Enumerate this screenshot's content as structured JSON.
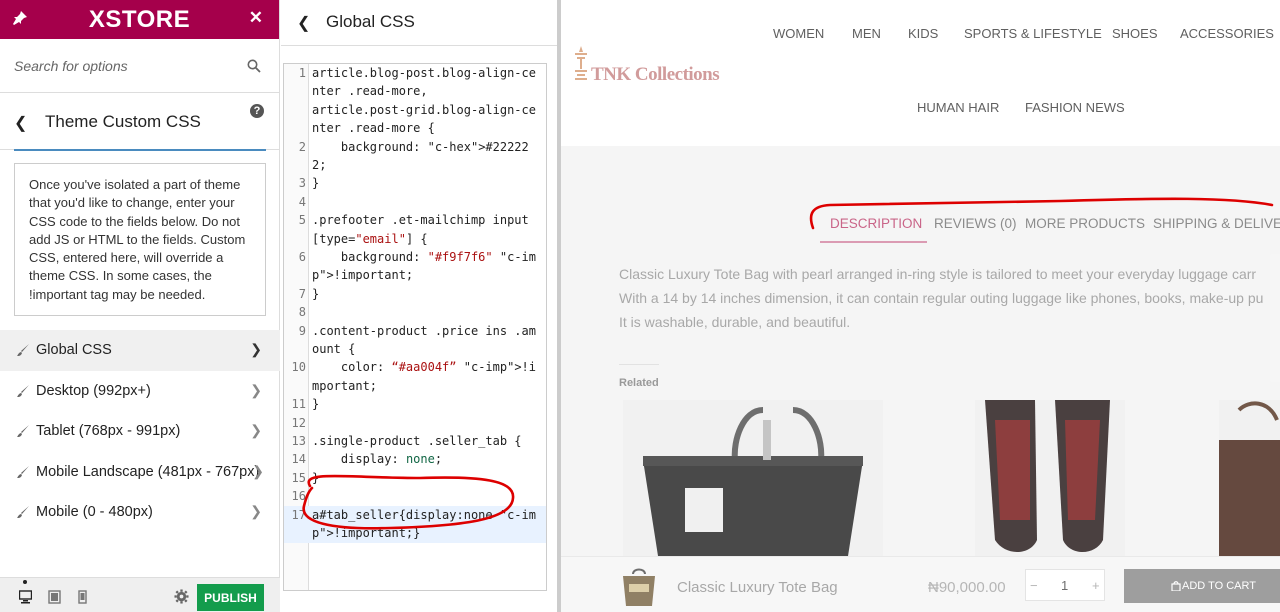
{
  "brand": {
    "logo": "XSTORE"
  },
  "search": {
    "placeholder": "Search for options"
  },
  "section": {
    "title": "Theme Custom CSS",
    "help": "?",
    "notice": "Once you've isolated a part of theme that you'd like to change, enter your CSS code to the fields below. Do not add JS or HTML to the fields. Custom CSS, entered here, will override a theme CSS. In some cases, the !important tag may be needed."
  },
  "menu": {
    "items": [
      {
        "label": "Global CSS"
      },
      {
        "label": "Desktop (992px+)"
      },
      {
        "label": "Tablet (768px - 991px)"
      },
      {
        "label": "Mobile Landscape (481px - 767px)"
      },
      {
        "label": "Mobile (0 - 480px)"
      }
    ]
  },
  "footer": {
    "publish": "PUBLISH"
  },
  "editor": {
    "title": "Global CSS",
    "lines": [
      {
        "n": "1",
        "text": "article.blog-post.blog-align-center .read-more,\narticle.post-grid.blog-align-center .read-more {"
      },
      {
        "n": "2",
        "text": "    background: #222222;"
      },
      {
        "n": "3",
        "text": "}"
      },
      {
        "n": "4",
        "text": ""
      },
      {
        "n": "5",
        "text": ".prefooter .et-mailchimp input[type=\"email\"] {"
      },
      {
        "n": "6",
        "text": "    background: \"#f9f7f6\" !important;"
      },
      {
        "n": "7",
        "text": "}"
      },
      {
        "n": "8",
        "text": ""
      },
      {
        "n": "9",
        "text": ".content-product .price ins .amount {"
      },
      {
        "n": "10",
        "text": "    color: “#aa004f” !important;"
      },
      {
        "n": "11",
        "text": "}"
      },
      {
        "n": "12",
        "text": ""
      },
      {
        "n": "13",
        "text": ".single-product .seller_tab {"
      },
      {
        "n": "14",
        "text": "    display: none;"
      },
      {
        "n": "15",
        "text": "}"
      },
      {
        "n": "16",
        "text": ""
      },
      {
        "n": "17",
        "text": "a#tab_seller{display:none !important;}"
      }
    ]
  },
  "preview": {
    "nav": [
      "WOMEN",
      "MEN",
      "KIDS",
      "SPORTS & LIFESTYLE",
      "SHOES",
      "ACCESSORIES",
      "HUMAN HAIR",
      "FASHION NEWS"
    ],
    "logo": "TNK Collections",
    "tabs": [
      "DESCRIPTION",
      "REVIEWS (0)",
      "MORE PRODUCTS",
      "SHIPPING & DELIVER"
    ],
    "description": [
      "Classic Luxury Tote Bag with pearl arranged in-ring style is tailored to meet your everyday luggage carr",
      "With a 14 by 14 inches dimension, it can contain regular outing luggage like phones, books, make-up pu",
      "It is washable, durable, and beautiful."
    ],
    "related": "Related",
    "sticky": {
      "product": "Classic Luxury Tote Bag",
      "price": "₦90,000.00",
      "qty_minus": "−",
      "qty": "1",
      "qty_plus": "+",
      "add_to_cart": "ADD TO CART"
    }
  },
  "colors": {
    "brand": "#a5004b",
    "publish": "#139c4c",
    "accent_tab": "#c04a74",
    "annotation": "#dd0000"
  }
}
